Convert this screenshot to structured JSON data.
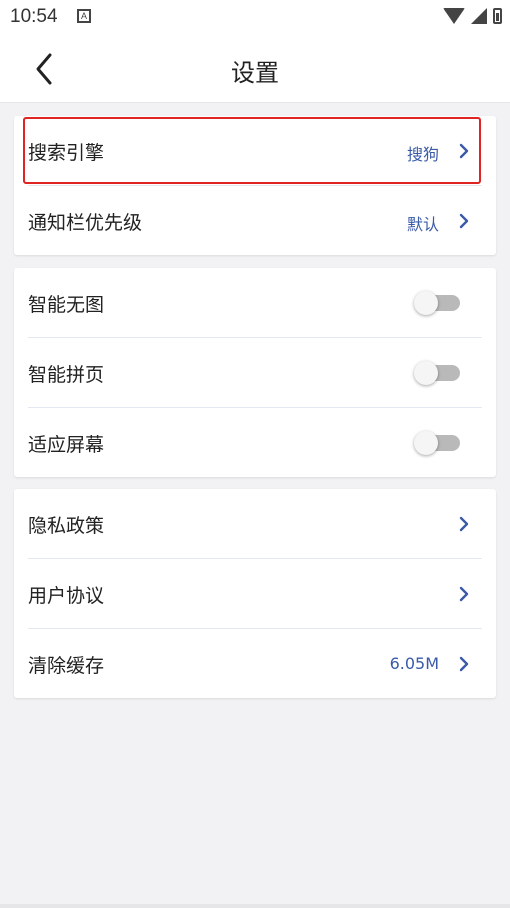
{
  "status_bar": {
    "time": "10:54",
    "notif_letter": "A"
  },
  "header": {
    "title": "设置"
  },
  "group1": [
    {
      "label": "搜索引擎",
      "value": "搜狗"
    },
    {
      "label": "通知栏优先级",
      "value": "默认"
    }
  ],
  "group2": [
    {
      "label": "智能无图",
      "enabled": false
    },
    {
      "label": "智能拼页",
      "enabled": false
    },
    {
      "label": "适应屏幕",
      "enabled": false
    }
  ],
  "group3": [
    {
      "label": "隐私政策",
      "value": ""
    },
    {
      "label": "用户协议",
      "value": ""
    },
    {
      "label": "清除缓存",
      "value": "6.05M"
    }
  ],
  "colors": {
    "accent": "#3a5aa8",
    "highlight": "#e02424",
    "background": "#f2f2f4"
  }
}
